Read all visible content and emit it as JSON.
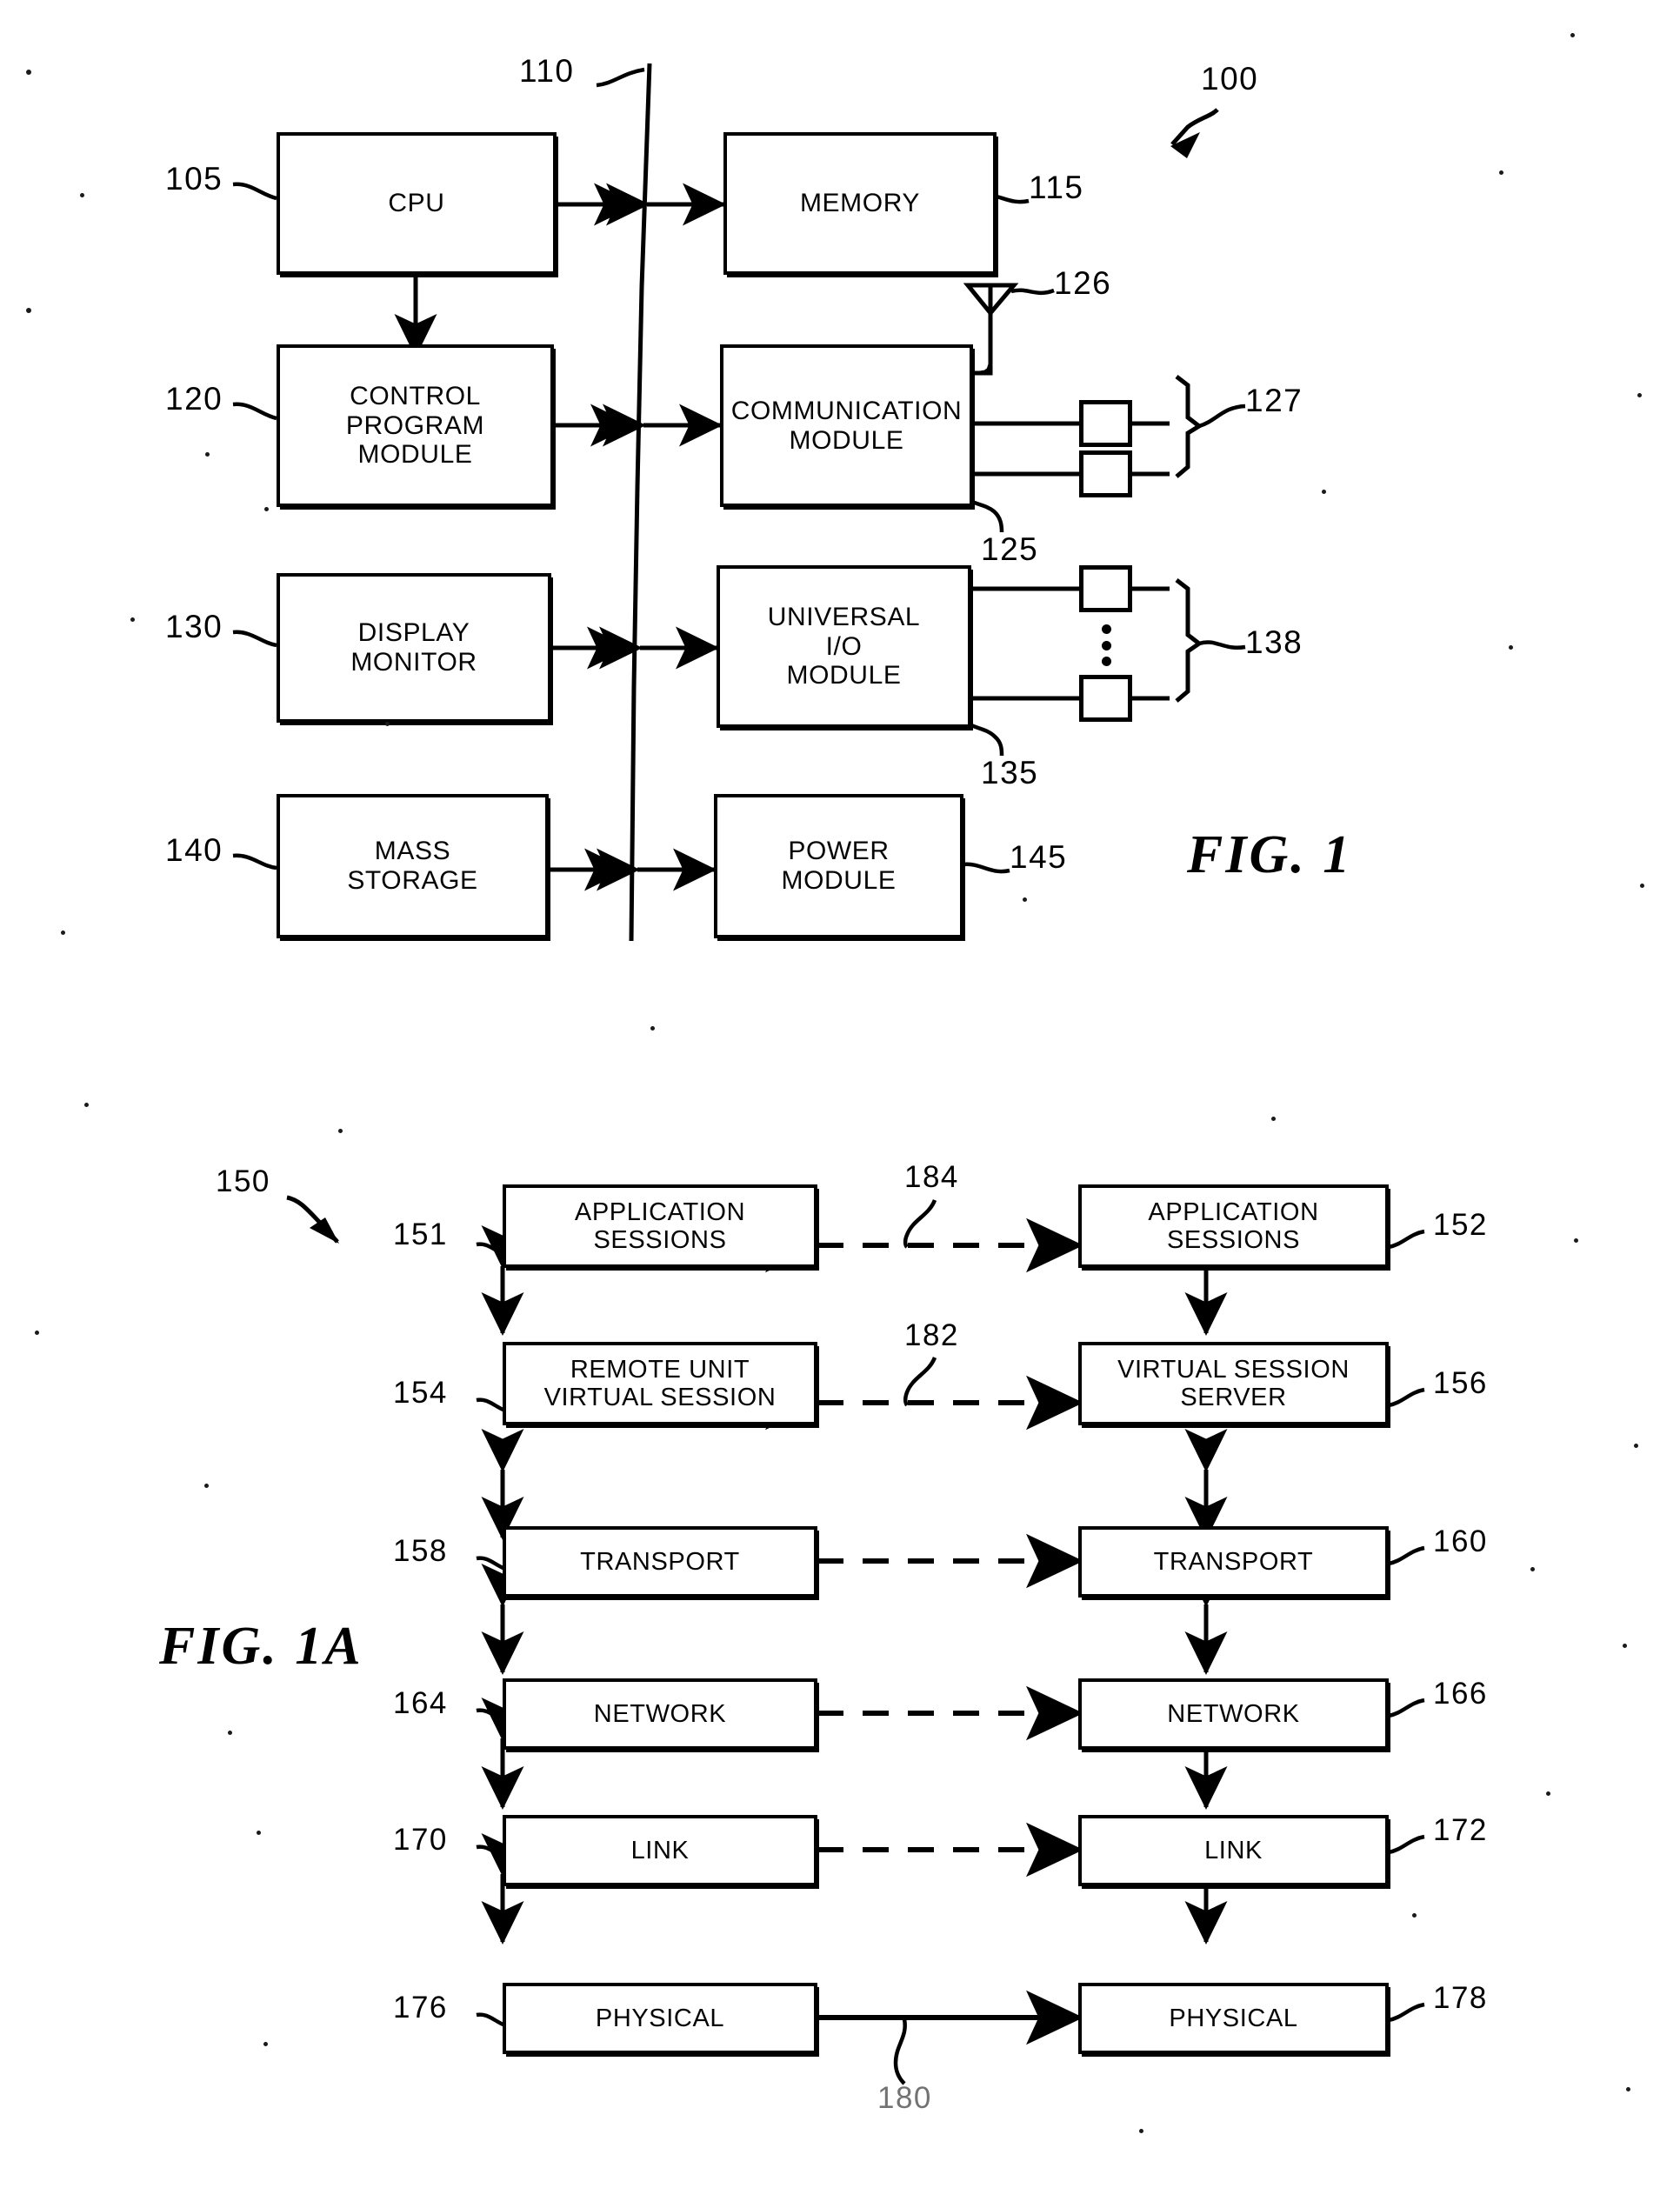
{
  "figures": [
    {
      "id": "fig1",
      "caption": "FIG.  1",
      "system_ref": "100",
      "bus_ref": "110",
      "blocks": [
        {
          "key": "cpu",
          "lines": [
            "CPU"
          ],
          "ref": "105"
        },
        {
          "key": "memory",
          "lines": [
            "MEMORY"
          ],
          "ref": "115"
        },
        {
          "key": "control",
          "lines": [
            "CONTROL",
            "PROGRAM",
            "MODULE"
          ],
          "ref": "120"
        },
        {
          "key": "comm",
          "lines": [
            "COMMUNICATION",
            "MODULE"
          ],
          "ref": "125"
        },
        {
          "key": "display",
          "lines": [
            "DISPLAY",
            "MONITOR"
          ],
          "ref": "130"
        },
        {
          "key": "uio",
          "lines": [
            "UNIVERSAL",
            "I/O",
            "MODULE"
          ],
          "ref": "135"
        },
        {
          "key": "mass",
          "lines": [
            "MASS",
            "STORAGE"
          ],
          "ref": "140"
        },
        {
          "key": "power",
          "lines": [
            "POWER",
            "MODULE"
          ],
          "ref": "145"
        }
      ],
      "peripherals": [
        {
          "key": "antenna",
          "ref": "126"
        },
        {
          "key": "comm-ports",
          "ref": "127"
        },
        {
          "key": "io-ports",
          "ref": "138"
        }
      ]
    },
    {
      "id": "fig1a",
      "caption": "FIG.  1A",
      "system_ref": "150",
      "left_column": [
        {
          "key": "app-sessions-left",
          "lines": [
            "APPLICATION",
            "SESSIONS"
          ],
          "ref": "151"
        },
        {
          "key": "remote-virtual",
          "lines": [
            "REMOTE  UNIT",
            "VIRTUAL  SESSION"
          ],
          "ref": "154"
        },
        {
          "key": "transport-left",
          "lines": [
            "TRANSPORT"
          ],
          "ref": "158"
        },
        {
          "key": "network-left",
          "lines": [
            "NETWORK"
          ],
          "ref": "164"
        },
        {
          "key": "link-left",
          "lines": [
            "LINK"
          ],
          "ref": "170"
        },
        {
          "key": "physical-left",
          "lines": [
            "PHYSICAL"
          ],
          "ref": "176"
        }
      ],
      "right_column": [
        {
          "key": "app-sessions-right",
          "lines": [
            "APPLICATION",
            "SESSIONS"
          ],
          "ref": "152"
        },
        {
          "key": "virtual-server",
          "lines": [
            "VIRTUAL  SESSION",
            "SERVER"
          ],
          "ref": "156"
        },
        {
          "key": "transport-right",
          "lines": [
            "TRANSPORT"
          ],
          "ref": "160"
        },
        {
          "key": "network-right",
          "lines": [
            "NETWORK"
          ],
          "ref": "166"
        },
        {
          "key": "link-right",
          "lines": [
            "LINK"
          ],
          "ref": "172"
        },
        {
          "key": "physical-right",
          "lines": [
            "PHYSICAL"
          ],
          "ref": "178"
        }
      ],
      "peer_links": [
        {
          "key": "app-link",
          "ref": "184"
        },
        {
          "key": "session-link",
          "ref": "182"
        },
        {
          "key": "physical-link",
          "ref": "180"
        }
      ]
    }
  ]
}
